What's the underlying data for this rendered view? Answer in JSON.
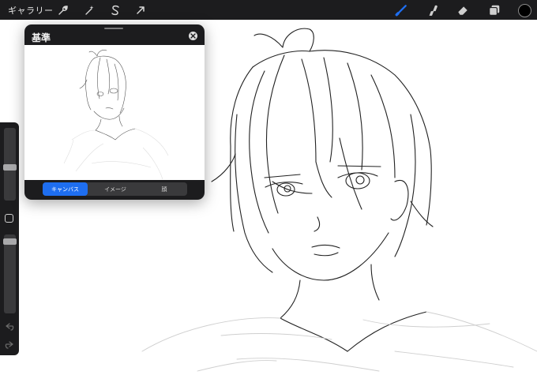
{
  "toolbar": {
    "gallery_label": "ギャラリー",
    "left_icons": [
      "wrench-icon",
      "magic-wand-icon",
      "selection-s-icon",
      "transform-arrow-icon"
    ],
    "right_icons": [
      "brush-icon",
      "smudge-icon",
      "eraser-icon",
      "layers-icon",
      "color-swatch"
    ],
    "brush_color": "#1e6ef0",
    "current_color": "#000000"
  },
  "sidebar": {
    "brush_size": 0.45,
    "opacity": 0.95,
    "icons": [
      "modify-square-icon",
      "undo-icon",
      "redo-icon"
    ]
  },
  "reference_panel": {
    "title": "基準",
    "close_icon": "close-circle-icon",
    "tabs": [
      {
        "label": "キャンバス",
        "active": true
      },
      {
        "label": "イメージ",
        "active": false
      },
      {
        "label": "顔",
        "active": false
      }
    ]
  },
  "colors": {
    "toolbar_bg": "#1c1c1e",
    "accent": "#1e6ef0",
    "canvas_bg": "#ffffff"
  }
}
